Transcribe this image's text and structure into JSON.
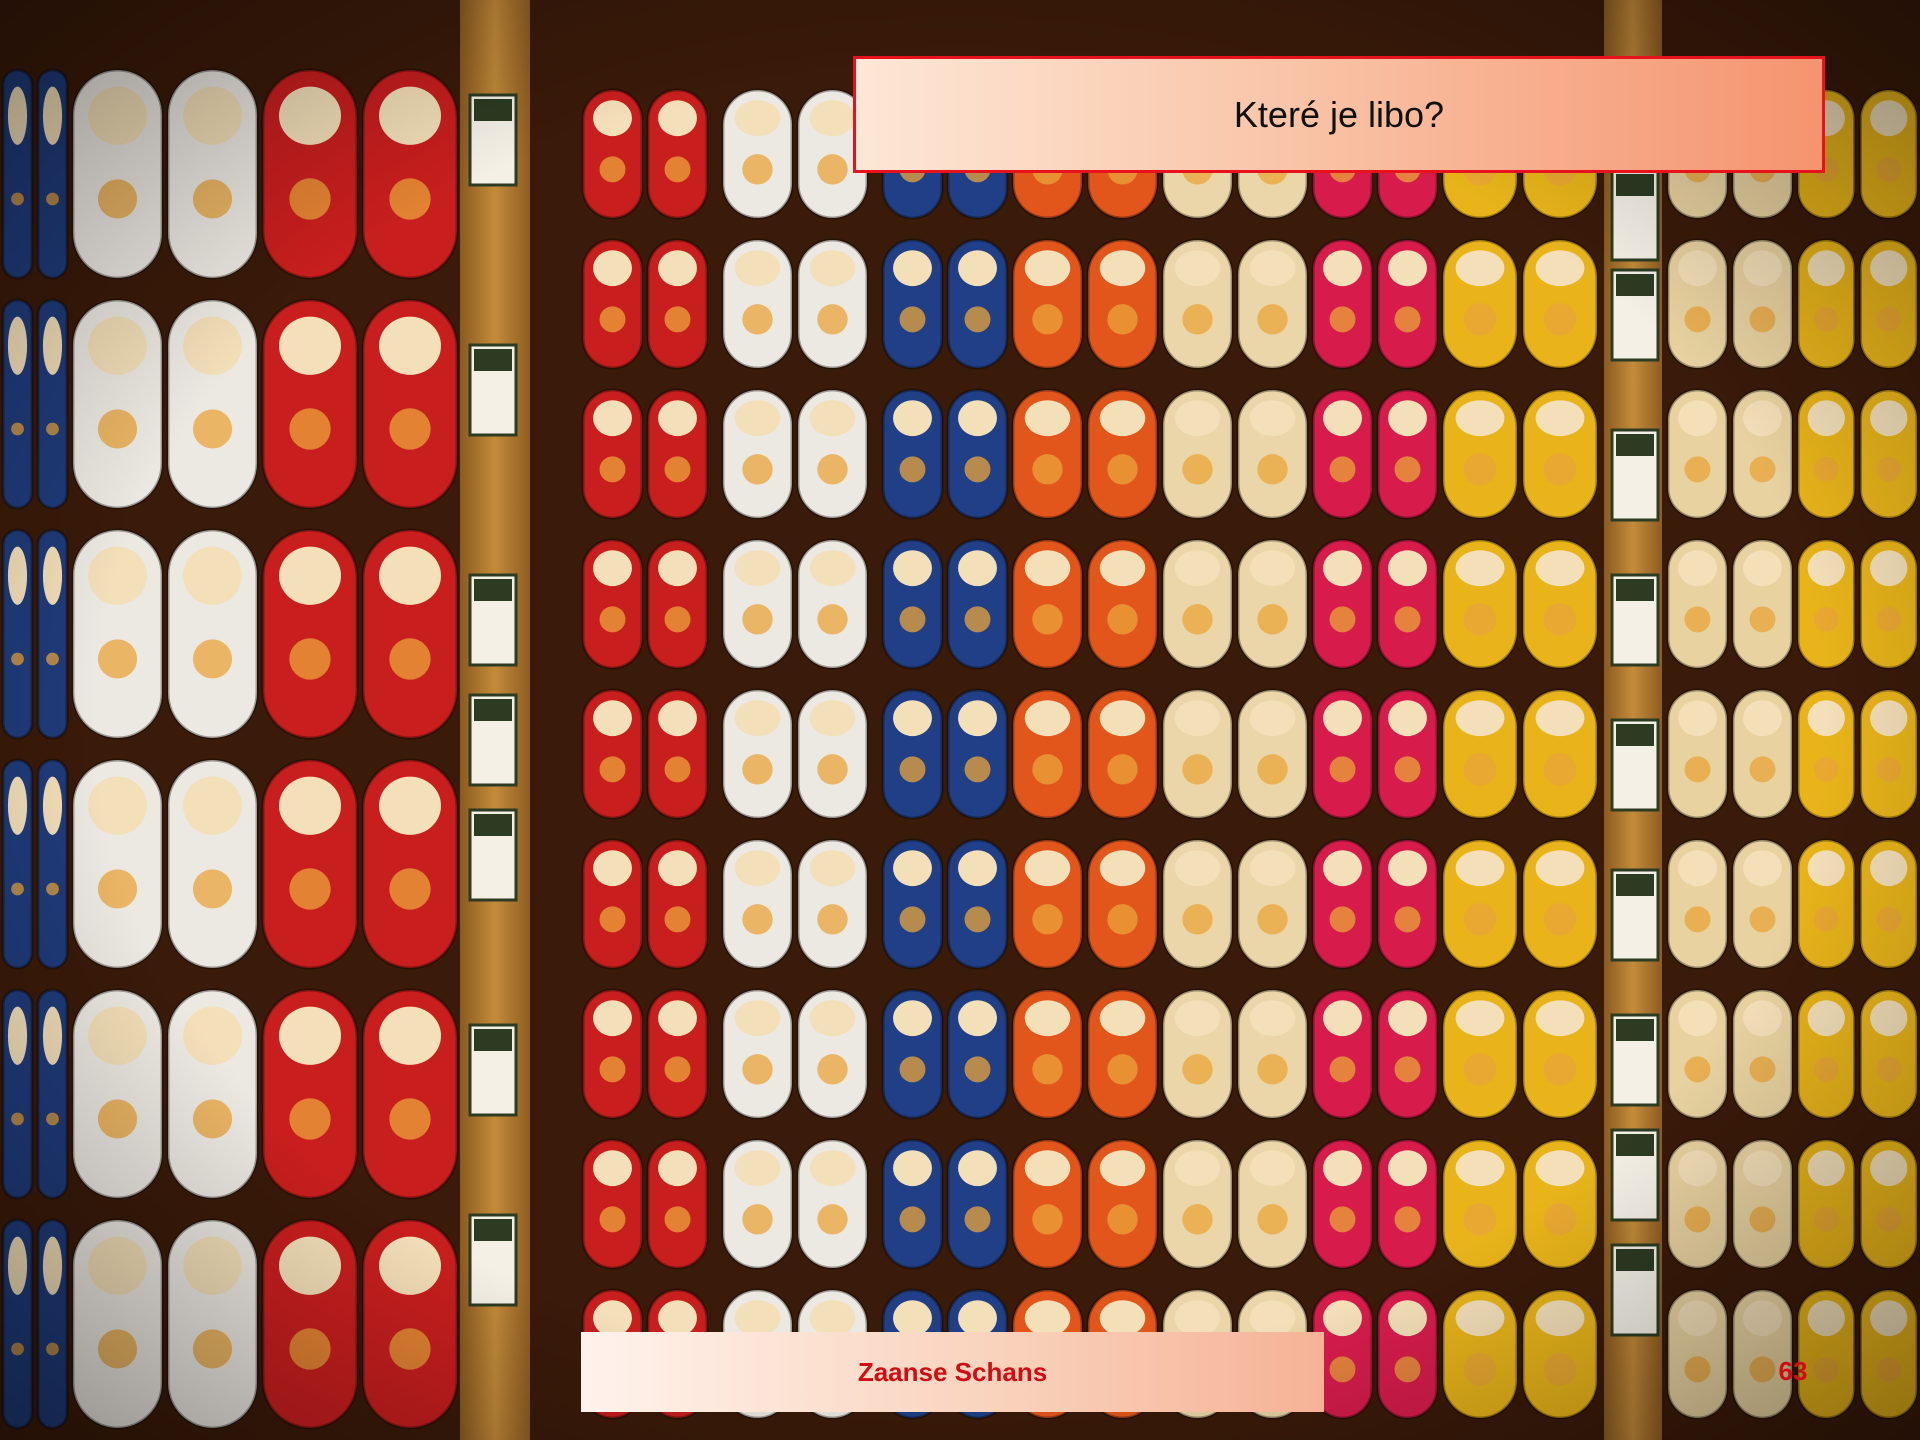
{
  "slide": {
    "title": "Které je libo?",
    "footer": "Zaanse Schans",
    "page_number": "63"
  },
  "photo": {
    "subject": "wall-of-wooden-clogs-icon",
    "palette": {
      "wood": "#b9812f",
      "background": "#3a1a09",
      "clog_colors": [
        "#1f3b7a",
        "#ece8e2",
        "#c91e1e",
        "#ece8e2",
        "#203f86",
        "#e2561c",
        "#ead6a8",
        "#d71c4c",
        "#e8b41a",
        "#e8d2a0"
      ]
    }
  }
}
